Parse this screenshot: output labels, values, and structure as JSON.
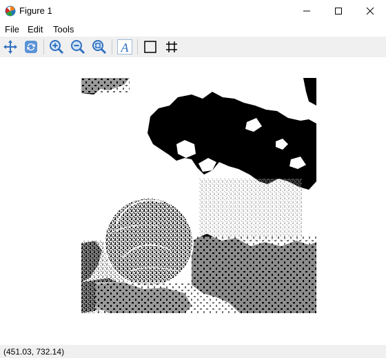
{
  "window": {
    "title": "Figure 1",
    "icon": "matplotlib-logo-icon",
    "controls": [
      "minimize-icon",
      "maximize-icon",
      "close-icon"
    ]
  },
  "menu": {
    "items": [
      "File",
      "Edit",
      "Tools"
    ]
  },
  "toolbar": {
    "buttons": [
      "pan-icon",
      "rotate-icon",
      "zoom-in-icon",
      "zoom-out-icon",
      "zoom-fit-icon",
      "text-A-icon",
      "rectangle-icon",
      "grid-icon"
    ],
    "accent": "#3a7bd5"
  },
  "figure": {
    "description_colors": {
      "foreground": "#000000",
      "background": "#ffffff"
    }
  },
  "status": {
    "coords": "(451.03, 732.14)"
  }
}
